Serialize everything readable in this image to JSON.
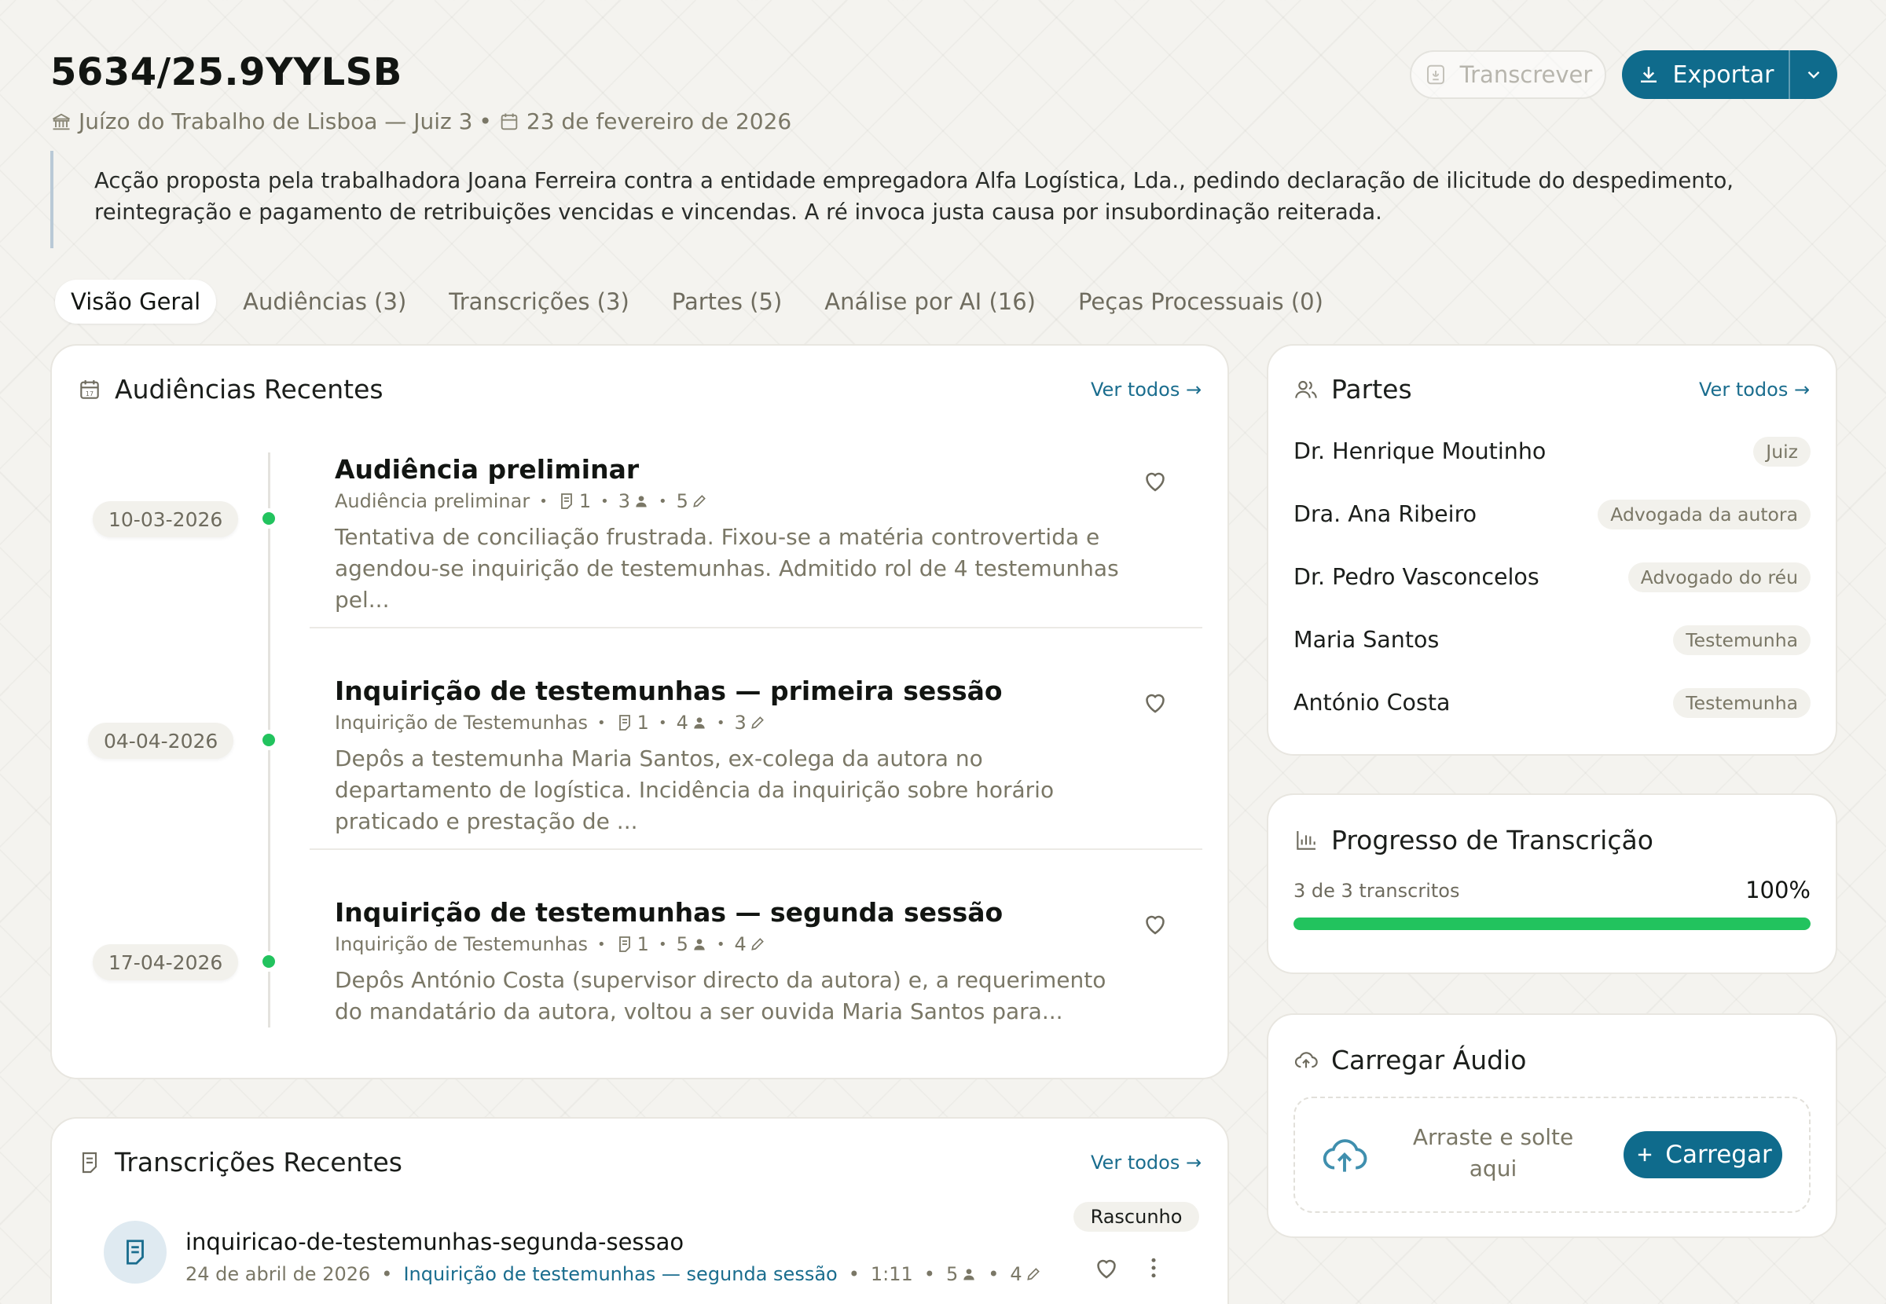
{
  "header": {
    "case_number": "5634/25.9YYLSB",
    "court": "Juízo do Trabalho de Lisboa — Juiz 3",
    "date": "23 de fevereiro de 2026",
    "separator": "•",
    "description": "Acção proposta pela trabalhadora Joana Ferreira contra a entidade empregadora Alfa Logística, Lda., pedindo declaração de ilicitude do despedimento, reintegração e pagamento de retribuições vencidas e vincendas. A ré invoca justa causa por insubordinação reiterada.",
    "transcribe_label": "Transcrever",
    "export_label": "Exportar"
  },
  "tabs": [
    {
      "label": "Visão Geral",
      "active": true
    },
    {
      "label": "Audiências (3)"
    },
    {
      "label": "Transcrições (3)"
    },
    {
      "label": "Partes (5)"
    },
    {
      "label": "Análise por AI (16)"
    },
    {
      "label": "Peças Processuais (0)"
    }
  ],
  "hearings": {
    "title": "Audiências Recentes",
    "see_all": "Ver todos →",
    "items": [
      {
        "date": "10-03-2026",
        "title": "Audiência preliminar",
        "type": "Audiência preliminar",
        "docs": "1",
        "people": "3",
        "edits": "5",
        "summary": "Tentativa de conciliação frustrada. Fixou-se a matéria controvertida e agendou-se inquirição de testemunhas. Admitido rol de 4 testemunhas pel..."
      },
      {
        "date": "04-04-2026",
        "title": "Inquirição de testemunhas — primeira sessão",
        "type": "Inquirição de Testemunhas",
        "docs": "1",
        "people": "4",
        "edits": "3",
        "summary": "Depôs a testemunha Maria Santos, ex-colega da autora no departamento de logística. Incidência da inquirição sobre horário praticado e prestação de ..."
      },
      {
        "date": "17-04-2026",
        "title": "Inquirição de testemunhas — segunda sessão",
        "type": "Inquirição de Testemunhas",
        "docs": "1",
        "people": "5",
        "edits": "4",
        "summary": "Depôs António Costa (supervisor directo da autora) e, a requerimento do mandatário da autora, voltou a ser ouvida Maria Santos para..."
      }
    ]
  },
  "parties": {
    "title": "Partes",
    "see_all": "Ver todos →",
    "items": [
      {
        "name": "Dr. Henrique Moutinho",
        "role": "Juiz"
      },
      {
        "name": "Dra. Ana Ribeiro",
        "role": "Advogada da autora"
      },
      {
        "name": "Dr. Pedro Vasconcelos",
        "role": "Advogado do réu"
      },
      {
        "name": "Maria Santos",
        "role": "Testemunha"
      },
      {
        "name": "António Costa",
        "role": "Testemunha"
      }
    ]
  },
  "progress": {
    "title": "Progresso de Transcrição",
    "label": "3 de 3 transcritos",
    "percent_label": "100%",
    "fraction": 1.0,
    "bar_color": "#22c35e"
  },
  "upload": {
    "title": "Carregar Áudio",
    "drop_text": "Arraste e solte aqui",
    "button_label": "Carregar"
  },
  "transcriptions": {
    "title": "Transcrições Recentes",
    "see_all": "Ver todos →",
    "items": [
      {
        "filename": "inquiricao-de-testemunhas-segunda-sessao",
        "status": "Rascunho",
        "date": "24 de abril de 2026",
        "hearing": "Inquirição de testemunhas — segunda sessão",
        "duration": "1:11",
        "people": "5",
        "edits": "4"
      }
    ]
  },
  "colors": {
    "accent": "#0f6b8c",
    "success": "#22c35e",
    "muted_text": "#7a7766"
  }
}
